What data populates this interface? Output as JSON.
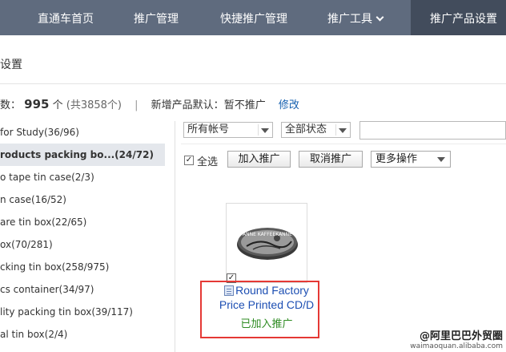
{
  "nav": {
    "items": [
      {
        "label": "直通车首页"
      },
      {
        "label": "推广管理"
      },
      {
        "label": "快捷推广管理"
      },
      {
        "label": "推广工具"
      },
      {
        "label": "推广产品设置"
      }
    ]
  },
  "page_title": "设置",
  "summary": {
    "prefix": "数：",
    "count": "995",
    "unit": "个",
    "total": "(共3858个)",
    "separator": "|",
    "default_label": "新增产品默认：",
    "default_value": "暂不推广",
    "edit_link": "修改"
  },
  "groups": [
    {
      "label": "for Study(36/96)"
    },
    {
      "label": "roducts packing bo...(24/72)"
    },
    {
      "label": "o tape tin case(2/3)"
    },
    {
      "label": "n case(16/52)"
    },
    {
      "label": "are tin box(22/65)"
    },
    {
      "label": "ox(70/281)"
    },
    {
      "label": "cking tin box(258/975)"
    },
    {
      "label": "cs container(34/97)"
    },
    {
      "label": "lity packing tin box(39/117)"
    },
    {
      "label": "al tin box(2/4)"
    }
  ],
  "filters": {
    "account": "所有帐号",
    "status": "全部状态",
    "search_value": ""
  },
  "toolbar": {
    "select_all": "全选",
    "add": "加入推广",
    "cancel": "取消推广",
    "more": "更多操作"
  },
  "product": {
    "title": "Round Factory Price Printed CD/D",
    "status": "已加入推广",
    "image_text": "ANNE KAFFEEKANNE"
  },
  "watermark": {
    "line1": "@阿里巴巴外贸圈",
    "line2": "waimaoquan.alibaba.com"
  },
  "colors": {
    "nav_bg": "#5f6b7e",
    "nav_active": "#424c5c",
    "link": "#1560b0",
    "added": "#2e8b22",
    "highlight": "#e53935"
  }
}
